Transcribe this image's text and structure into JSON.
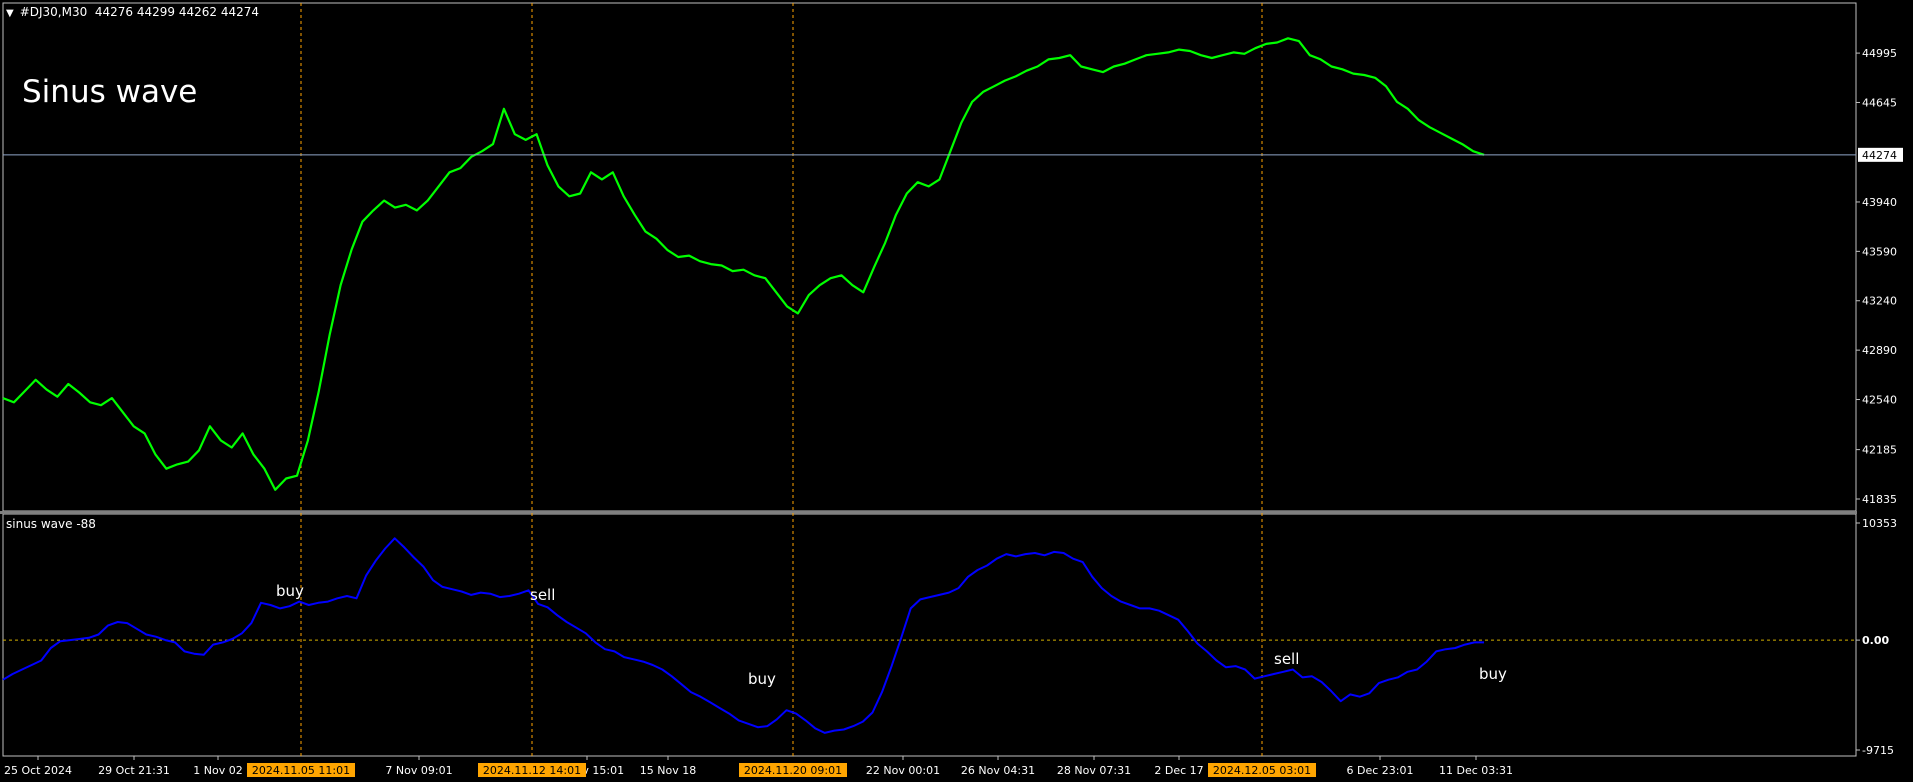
{
  "header": {
    "symbol": "#DJ30,M30",
    "ohlc": "44276 44299 44262 44274"
  },
  "overlay_title": "Sinus wave",
  "indicator": {
    "title": "sinus wave -88"
  },
  "signals": [
    {
      "label": "buy"
    },
    {
      "label": "sell"
    },
    {
      "label": "buy"
    },
    {
      "label": "sell"
    },
    {
      "label": "buy"
    }
  ],
  "colors": {
    "price": "#00ff00",
    "indicator": "#0000ff",
    "grid_marker": "#ffa500",
    "current_line": "#8fa6c9",
    "zero_line": "#d4b000",
    "separator": "#808080"
  },
  "chart_data": [
    {
      "type": "line",
      "title": "#DJ30,M30",
      "x_ticks": [
        "25 Oct 2024",
        "29 Oct 21:31",
        "1 Nov 02",
        "7 Nov 09:01",
        "13 Nov 15:01",
        "15 Nov 18",
        "22 Nov 00:01",
        "26 Nov 04:31",
        "28 Nov 07:31",
        "2 Dec 17",
        "6 Dec 23:01",
        "11 Dec 03:31"
      ],
      "x_markers": [
        "2024.11.05 11:01",
        "2024.11.12 14:01",
        "2024.11.20 09:01",
        "2024.12.05 03:01"
      ],
      "y_ticks": [
        41835,
        42185,
        42540,
        42890,
        43240,
        43590,
        43940,
        44274,
        44645,
        44995
      ],
      "current_price": 44274,
      "ylim": [
        41750,
        45350
      ],
      "series": [
        {
          "values": [
            42550,
            42520,
            42600,
            42680,
            42610,
            42560,
            42650,
            42590,
            42520,
            42500,
            42550,
            42450,
            42350,
            42300,
            42150,
            42050,
            42080,
            42100,
            42180,
            42350,
            42250,
            42200,
            42300,
            42150,
            42050,
            41900,
            41980,
            42000,
            42250,
            42600,
            43000,
            43350,
            43600,
            43800,
            43880,
            43950,
            43900,
            43920,
            43880,
            43950,
            44050,
            44150,
            44180,
            44260,
            44300,
            44350,
            44600,
            44420,
            44380,
            44420,
            44200,
            44050,
            43980,
            44000,
            44150,
            44100,
            44150,
            43980,
            43850,
            43730,
            43680,
            43600,
            43550,
            43560,
            43520,
            43500,
            43490,
            43450,
            43460,
            43420,
            43400,
            43300,
            43200,
            43150,
            43280,
            43350,
            43400,
            43420,
            43350,
            43300,
            43480,
            43650,
            43850,
            44000,
            44080,
            44050,
            44100,
            44300,
            44500,
            44650,
            44720,
            44760,
            44800,
            44830,
            44870,
            44900,
            44950,
            44960,
            44980,
            44900,
            44880,
            44860,
            44900,
            44920,
            44950,
            44980,
            44990,
            45000,
            45020,
            45010,
            44980,
            44960,
            44980,
            45000,
            44990,
            45030,
            45060,
            45070,
            45100,
            45080,
            44980,
            44950,
            44900,
            44880,
            44850,
            44840,
            44820,
            44760,
            44650,
            44600,
            44520,
            44470,
            44430,
            44390,
            44350,
            44300,
            44274
          ]
        }
      ]
    },
    {
      "type": "line",
      "title": "sinus wave -88",
      "y_ticks": [
        10353,
        0.0,
        -9715
      ],
      "ylim": [
        -9715,
        10353
      ],
      "series": [
        {
          "values": [
            -3500,
            -3000,
            -2600,
            -2200,
            -1800,
            -700,
            -100,
            0,
            100,
            200,
            500,
            1300,
            1600,
            1500,
            1000,
            500,
            300,
            0,
            -200,
            -1000,
            -1200,
            -1300,
            -400,
            -200,
            100,
            600,
            1500,
            3300,
            3100,
            2800,
            3000,
            3400,
            3100,
            3300,
            3400,
            3700,
            3900,
            3700,
            5700,
            7000,
            8100,
            9000,
            8200,
            7300,
            6500,
            5300,
            4700,
            4500,
            4300,
            4000,
            4200,
            4100,
            3800,
            3900,
            4100,
            4400,
            3200,
            2900,
            2200,
            1600,
            1100,
            600,
            -200,
            -800,
            -1000,
            -1500,
            -1700,
            -1900,
            -2200,
            -2600,
            -3200,
            -3900,
            -4600,
            -5000,
            -5500,
            -6000,
            -6500,
            -7100,
            -7400,
            -7700,
            -7600,
            -7000,
            -6200,
            -6500,
            -7100,
            -7800,
            -8200,
            -8000,
            -7900,
            -7600,
            -7200,
            -6400,
            -4600,
            -2300,
            200,
            2800,
            3600,
            3800,
            4000,
            4200,
            4600,
            5600,
            6200,
            6600,
            7200,
            7600,
            7400,
            7600,
            7700,
            7500,
            7800,
            7700,
            7200,
            6900,
            5600,
            4600,
            3900,
            3400,
            3100,
            2800,
            2800,
            2600,
            2200,
            1800,
            800,
            -300,
            -1000,
            -1800,
            -2400,
            -2300,
            -2600,
            -3400,
            -3200,
            -3000,
            -2800,
            -2600,
            -3300,
            -3200,
            -3700,
            -4500,
            -5400,
            -4800,
            -5000,
            -4700,
            -3800,
            -3500,
            -3300,
            -2800,
            -2600,
            -1900,
            -1000,
            -800,
            -700,
            -400,
            -200,
            -200
          ]
        }
      ]
    }
  ]
}
